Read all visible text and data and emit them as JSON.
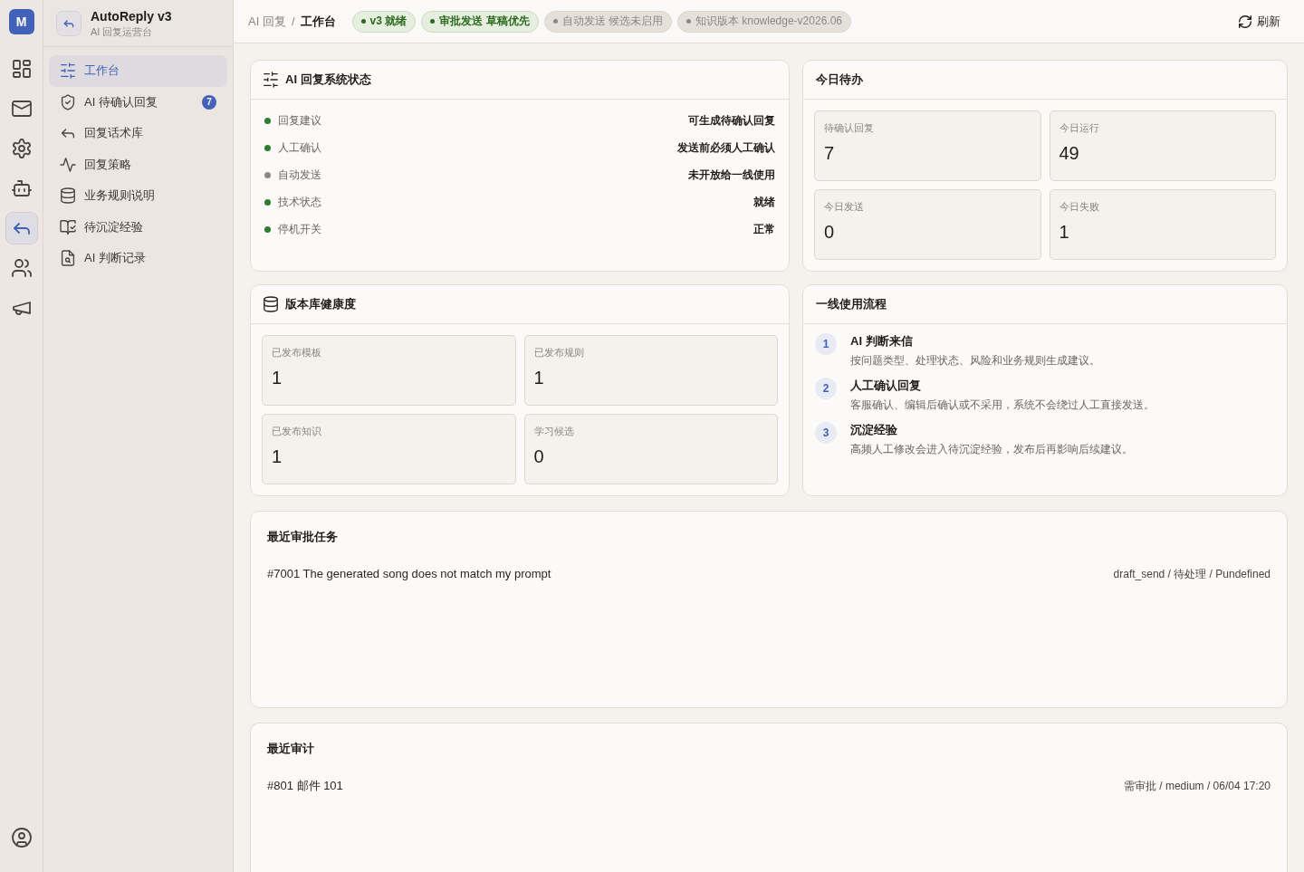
{
  "rail": {
    "avatar": "M",
    "items": [
      {
        "selected": false
      },
      {
        "selected": false
      },
      {
        "selected": false
      },
      {
        "selected": false
      },
      {
        "selected": true
      },
      {
        "selected": false
      },
      {
        "selected": false
      }
    ]
  },
  "sidebar": {
    "title": "AutoReply v3",
    "subtitle": "AI 回复运营台",
    "items": [
      {
        "label": "工作台",
        "selected": true
      },
      {
        "label": "AI 待确认回复",
        "selected": false,
        "badge": "7"
      },
      {
        "label": "回复话术库",
        "selected": false
      },
      {
        "label": "回复策略",
        "selected": false
      },
      {
        "label": "业务规则说明",
        "selected": false
      },
      {
        "label": "待沉淀经验",
        "selected": false
      },
      {
        "label": "AI 判断记录",
        "selected": false
      }
    ]
  },
  "topbar": {
    "breadcrumb": {
      "parent": "AI 回复",
      "separator": "/",
      "current": "工作台"
    },
    "pills": [
      {
        "label": "v3 就绪",
        "enabled": true
      },
      {
        "label": "审批发送 草稿优先",
        "enabled": true
      },
      {
        "label": "自动发送 候选未启用",
        "enabled": false
      },
      {
        "label": "知识版本 knowledge-v2026.06",
        "enabled": false
      }
    ],
    "refresh": "刷新"
  },
  "system_status": {
    "title": "AI 回复系统状态",
    "rows": [
      {
        "label": "回复建议",
        "value": "可生成待确认回复",
        "color": "#2e7d32"
      },
      {
        "label": "人工确认",
        "value": "发送前必须人工确认",
        "color": "#2e7d32"
      },
      {
        "label": "自动发送",
        "value": "未开放给一线使用",
        "color": "#8e8985"
      },
      {
        "label": "技术状态",
        "value": "就绪",
        "color": "#2e7d32"
      },
      {
        "label": "停机开关",
        "value": "正常",
        "color": "#2e7d32"
      }
    ]
  },
  "today_todo": {
    "title": "今日待办",
    "stats": [
      {
        "label": "待确认回复",
        "value": "7"
      },
      {
        "label": "今日运行",
        "value": "49"
      },
      {
        "label": "今日发送",
        "value": "0"
      },
      {
        "label": "今日失败",
        "value": "1"
      }
    ]
  },
  "library_health": {
    "title": "版本库健康度",
    "stats": [
      {
        "label": "已发布模板",
        "value": "1"
      },
      {
        "label": "已发布规则",
        "value": "1"
      },
      {
        "label": "已发布知识",
        "value": "1"
      },
      {
        "label": "学习候选",
        "value": "0"
      }
    ]
  },
  "usage_flow": {
    "title": "一线使用流程",
    "steps": [
      {
        "number": "1",
        "title": "AI 判断来信",
        "description": "按问题类型、处理状态、风险和业务规则生成建议。"
      },
      {
        "number": "2",
        "title": "人工确认回复",
        "description": "客服确认、编辑后确认或不采用，系统不会绕过人工直接发送。"
      },
      {
        "number": "3",
        "title": "沉淀经验",
        "description": "高频人工修改会进入待沉淀经验，发布后再影响后续建议。"
      }
    ]
  },
  "recent_approvals": {
    "title": "最近审批任务",
    "rows": [
      {
        "summary": "#7001 The generated song does not match my prompt",
        "meta": "draft_send / 待处理 / Pundefined"
      }
    ]
  },
  "recent_audits": {
    "title": "最近审计",
    "rows": [
      {
        "summary": "#801 邮件 101",
        "meta": "需审批 / medium / 06/04 17:20"
      }
    ]
  }
}
